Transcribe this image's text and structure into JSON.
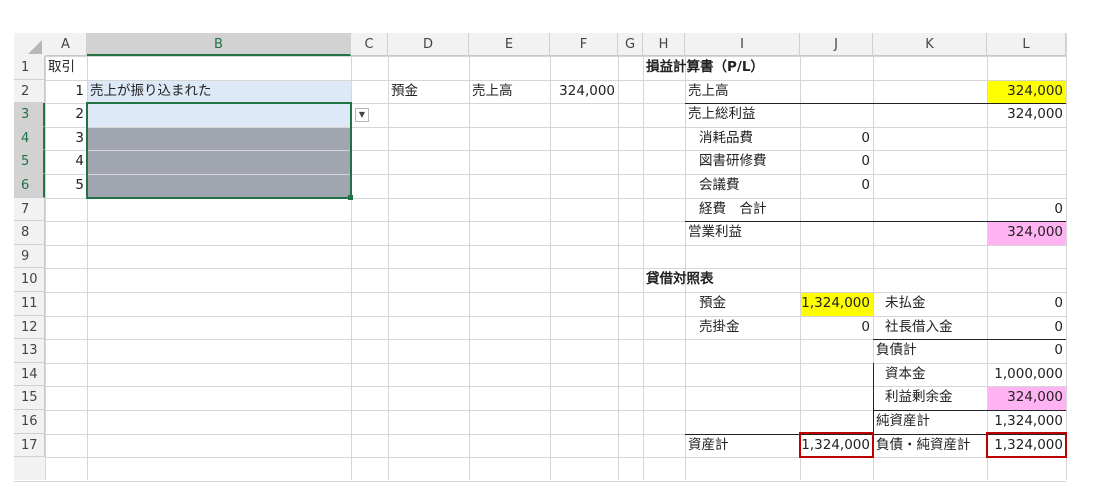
{
  "columns": [
    "A",
    "B",
    "C",
    "D",
    "E",
    "F",
    "G",
    "H",
    "I",
    "J",
    "K",
    "L"
  ],
  "selected_column": "B",
  "rows": [
    "1",
    "2",
    "3",
    "4",
    "5",
    "6",
    "7",
    "8",
    "9",
    "10",
    "11",
    "12",
    "13",
    "14",
    "15",
    "16",
    "17"
  ],
  "selected_rows": [
    "3",
    "4",
    "5",
    "6"
  ],
  "colors": {
    "yellow": "#ffff00",
    "pink": "#ffb3f2",
    "blue_selection": "#dde9f6",
    "gray_fill": "#a0a5b0",
    "red_outline": "#c00000",
    "excel_green": "#217346"
  },
  "icons": {
    "dropdown": "chevron-down-icon",
    "select_all": "select-all-triangle-icon"
  },
  "cells": {
    "A1": "取引",
    "A2": "1",
    "B2": "売上が振り込まれた",
    "A3": "2",
    "A4": "3",
    "A5": "4",
    "A6": "5",
    "D2": "預金",
    "E2": "売上高",
    "F2": "324,000",
    "H1": "損益計算書（P/L）",
    "I2": "売上高",
    "L2": "324,000",
    "I3": "売上総利益",
    "L3": "324,000",
    "I4": "消耗品費",
    "J4": "0",
    "I5": "図書研修費",
    "J5": "0",
    "I6": "会議費",
    "J6": "0",
    "I7": "経費　合計",
    "L7": "0",
    "I8": "営業利益",
    "L8": "324,000",
    "H10": "貸借対照表",
    "I11": "預金",
    "J11": "1,324,000",
    "K11": "未払金",
    "L11": "0",
    "I12": "売掛金",
    "J12": "0",
    "K12": "社長借入金",
    "L12": "0",
    "K13": "負債計",
    "L13": "0",
    "K14": "資本金",
    "L14": "1,000,000",
    "K15": "利益剰余金",
    "L15": "324,000",
    "K16": "純資産計",
    "L16": "1,324,000",
    "I17": "資産計",
    "J17": "1,324,000",
    "K17": "負債・純資産計",
    "L17": "1,324,000"
  }
}
